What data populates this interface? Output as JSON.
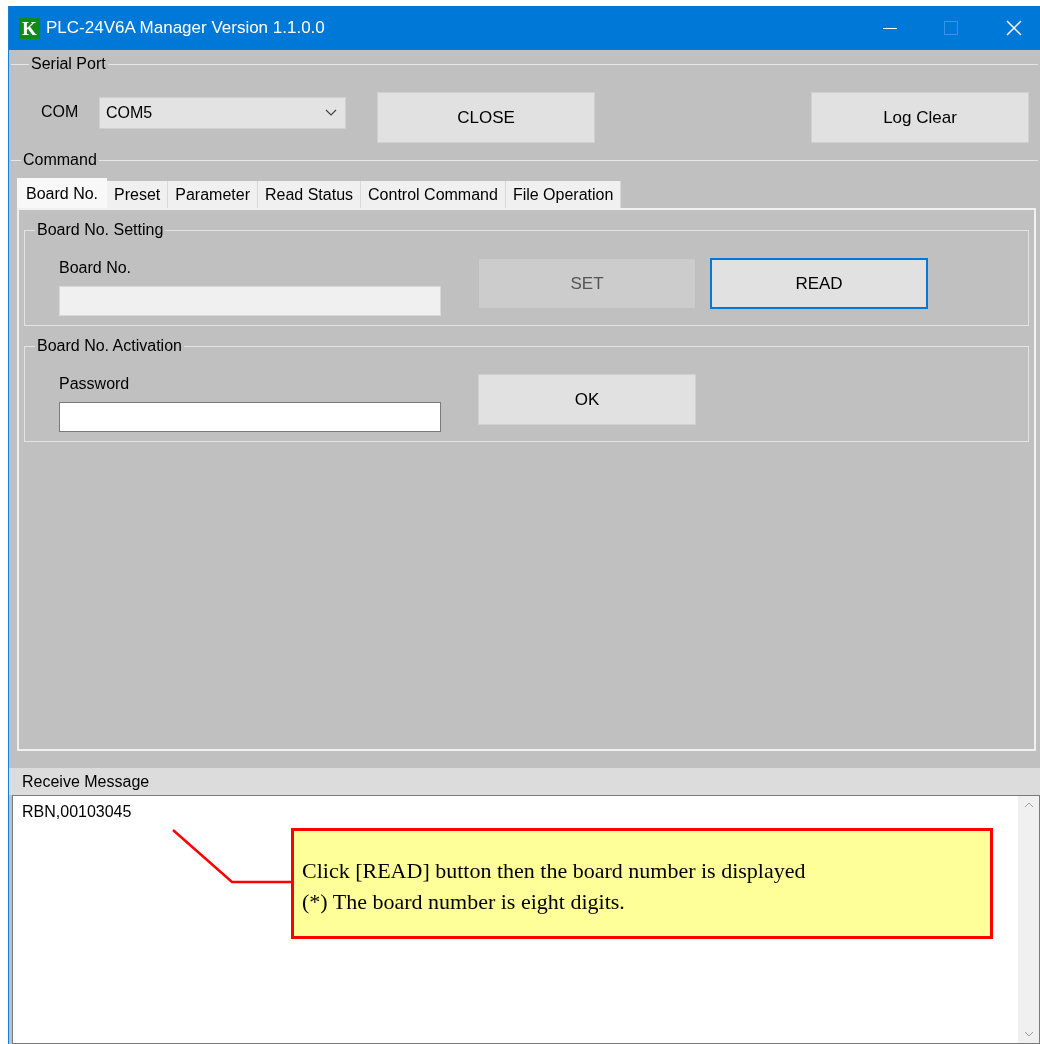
{
  "window": {
    "title": "PLC-24V6A Manager Version 1.1.0.0",
    "logo": "K"
  },
  "serial_port": {
    "title": "Serial Port",
    "com_label": "COM",
    "com_value": "COM5",
    "buttons": [
      {
        "label": "CLOSE"
      },
      {
        "label": "Log Clear"
      }
    ]
  },
  "command": {
    "title": "Command",
    "tabs": [
      {
        "label": "Board No.",
        "selected": true
      },
      {
        "label": "Preset",
        "selected": false
      },
      {
        "label": "Parameter",
        "selected": false
      },
      {
        "label": "Read Status",
        "selected": false
      },
      {
        "label": "Control Command",
        "selected": false
      },
      {
        "label": "File Operation",
        "selected": false
      }
    ],
    "groups": [
      {
        "title": "Board No. Setting",
        "field_label": "Board No.",
        "field_disabled": true,
        "buttons": [
          {
            "label": "SET",
            "disabled": true,
            "focused": false
          },
          {
            "label": "READ",
            "disabled": false,
            "focused": true
          }
        ]
      },
      {
        "title": "Board No. Activation",
        "field_label": "Password",
        "field_disabled": false,
        "buttons": [
          {
            "label": "OK",
            "disabled": false,
            "focused": false
          }
        ]
      }
    ]
  },
  "receive": {
    "title": "Receive Message",
    "lines": [
      "RBN,00103045"
    ]
  },
  "annotation": {
    "lines": [
      "Click [READ] button then the board number is displayed",
      "(*) The board number is eight digits."
    ]
  }
}
